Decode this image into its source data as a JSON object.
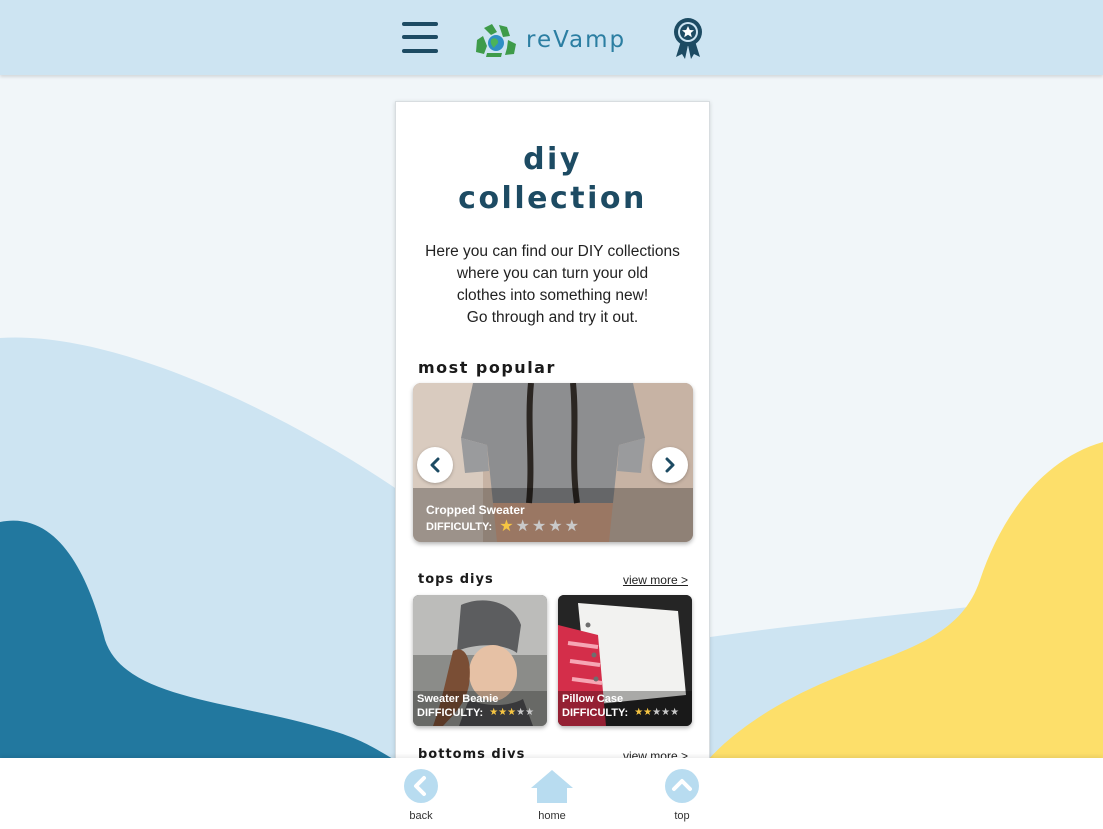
{
  "colors": {
    "topbar": "#cde4f2",
    "title": "#1d4b63",
    "brand": "#2b7ea2",
    "star_on": "#f6c542",
    "star_off": "#c9c9c9",
    "wave_light": "#cde4f2",
    "wave_dark": "#22789f",
    "wave_yellow": "#fddf6a",
    "nav_icon": "#b8dcf0"
  },
  "header": {
    "menu_icon": "hamburger-menu-icon",
    "logo_icon": "recycle-globe-icon",
    "logo_text": "reVamp",
    "award_icon": "award-ribbon-icon"
  },
  "page": {
    "title_line1": "diy",
    "title_line2": "collection",
    "intro_lines": [
      "Here you can find our DIY collections",
      "where you can turn your old",
      "clothes into something new!",
      "Go through and try it out."
    ]
  },
  "most_popular": {
    "heading": "most popular",
    "slide": {
      "name": "Cropped Sweater",
      "difficulty_label": "DIFFICULTY:",
      "difficulty": 1,
      "max": 5
    },
    "prev_icon": "chevron-left-icon",
    "next_icon": "chevron-right-icon"
  },
  "tops": {
    "heading": "tops diys",
    "view_more": "view more >",
    "items": [
      {
        "name": "Sweater Beanie",
        "difficulty_label": "DIFFICULTY:",
        "difficulty": 3,
        "max": 5
      },
      {
        "name": "Pillow Case",
        "difficulty_label": "DIFFICULTY:",
        "difficulty": 2,
        "max": 5
      }
    ]
  },
  "bottoms": {
    "heading": "bottoms diys",
    "view_more": "view more >"
  },
  "bottom_nav": {
    "back": {
      "label": "back",
      "icon": "back-arrow-icon"
    },
    "home": {
      "label": "home",
      "icon": "home-icon"
    },
    "top": {
      "label": "top",
      "icon": "up-arrow-icon"
    }
  }
}
